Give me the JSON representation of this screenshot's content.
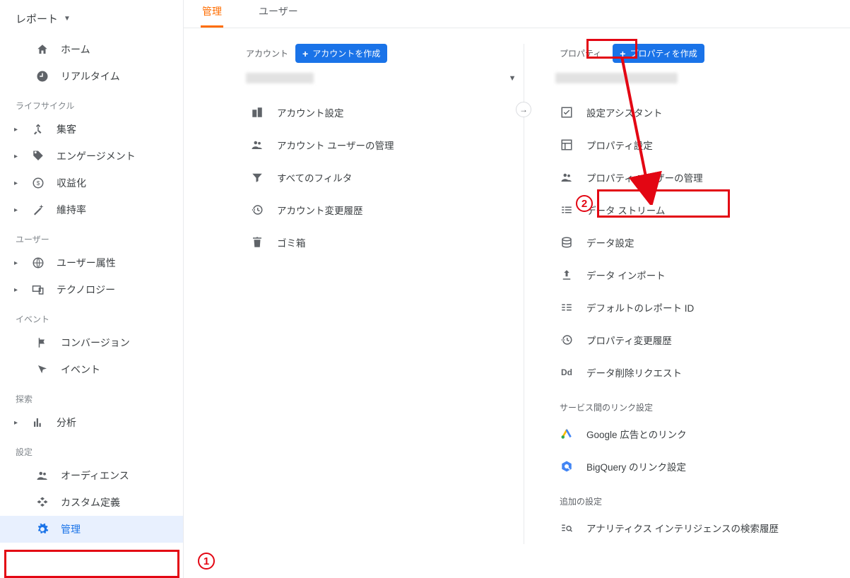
{
  "report_dropdown": "レポート",
  "sidebar": {
    "top": [
      {
        "label": "ホーム",
        "icon": "home"
      },
      {
        "label": "リアルタイム",
        "icon": "clock"
      }
    ],
    "sections": [
      {
        "title": "ライフサイクル",
        "items": [
          {
            "label": "集客",
            "icon": "share"
          },
          {
            "label": "エンゲージメント",
            "icon": "tag"
          },
          {
            "label": "収益化",
            "icon": "dollar"
          },
          {
            "label": "維持率",
            "icon": "wand"
          }
        ]
      },
      {
        "title": "ユーザー",
        "items": [
          {
            "label": "ユーザー属性",
            "icon": "globe"
          },
          {
            "label": "テクノロジー",
            "icon": "devices"
          }
        ]
      },
      {
        "title": "イベント",
        "items": [
          {
            "label": "コンバージョン",
            "icon": "flag"
          },
          {
            "label": "イベント",
            "icon": "cursor"
          }
        ]
      },
      {
        "title": "探索",
        "items": [
          {
            "label": "分析",
            "icon": "chart"
          }
        ]
      },
      {
        "title": "設定",
        "items": [
          {
            "label": "オーディエンス",
            "icon": "people"
          },
          {
            "label": "カスタム定義",
            "icon": "blocks"
          },
          {
            "label": "管理",
            "icon": "gear",
            "active": true
          }
        ]
      }
    ]
  },
  "tabs": [
    {
      "label": "管理",
      "active": true
    },
    {
      "label": "ユーザー",
      "active": false
    }
  ],
  "accountCol": {
    "label": "アカウント",
    "createBtn": "アカウントを作成",
    "items": [
      {
        "label": "アカウント設定",
        "icon": "building"
      },
      {
        "label": "アカウント ユーザーの管理",
        "icon": "people"
      },
      {
        "label": "すべてのフィルタ",
        "icon": "filter"
      },
      {
        "label": "アカウント変更履歴",
        "icon": "history"
      },
      {
        "label": "ゴミ箱",
        "icon": "trash"
      }
    ]
  },
  "propertyCol": {
    "label": "プロパティ",
    "createBtn": "プロパティを作成",
    "items": [
      {
        "label": "設定アシスタント",
        "icon": "assist"
      },
      {
        "label": "プロパティ設定",
        "icon": "layout"
      },
      {
        "label": "プロパティ ユーザーの管理",
        "icon": "people"
      },
      {
        "label": "データ ストリーム",
        "icon": "stream"
      },
      {
        "label": "データ設定",
        "icon": "database"
      },
      {
        "label": "データ インポート",
        "icon": "upload"
      },
      {
        "label": "デフォルトのレポート ID",
        "icon": "reportid"
      },
      {
        "label": "プロパティ変更履歴",
        "icon": "history"
      },
      {
        "label": "データ削除リクエスト",
        "icon": "dd"
      }
    ],
    "subhead1": "サービス間のリンク設定",
    "links": [
      {
        "label": "Google 広告とのリンク",
        "icon": "ads"
      },
      {
        "label": "BigQuery のリンク設定",
        "icon": "bq"
      }
    ],
    "subhead2": "追加の設定",
    "extra": [
      {
        "label": "アナリティクス インテリジェンスの検索履歴",
        "icon": "search"
      }
    ]
  },
  "annotations": {
    "num1": "1",
    "num2": "2"
  }
}
